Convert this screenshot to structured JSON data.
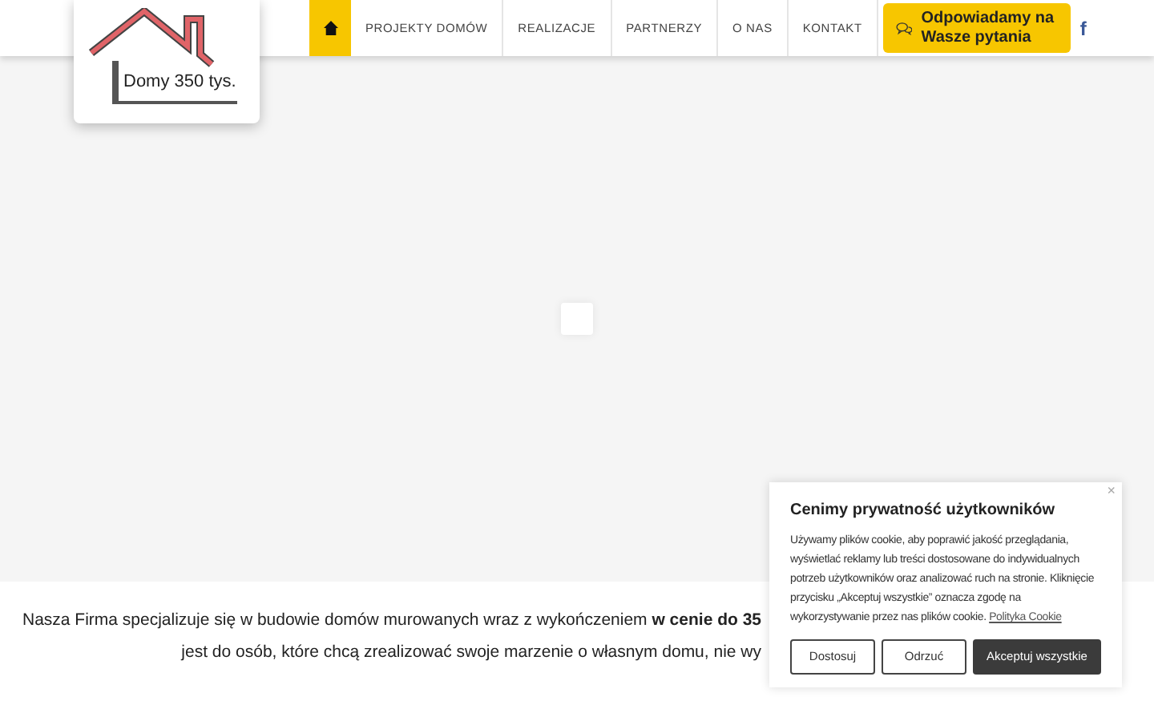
{
  "logo": {
    "text": "Domy 350 tys."
  },
  "nav": {
    "items": [
      {
        "label": "PROJEKTY DOMÓW"
      },
      {
        "label": "REALIZACJE"
      },
      {
        "label": "PARTNERZY"
      },
      {
        "label": "O NAS"
      },
      {
        "label": "KONTAKT"
      }
    ],
    "cta": {
      "label": "Odpowiadamy na Wasze pytania"
    },
    "social": {
      "label": "f"
    }
  },
  "intro": {
    "lines": [
      "Nasza Firma specjalizuje się w budowie domów murowanych wraz z wykończeniem **w cenie do 35**",
      "jest do osób, które chcą zrealizować swoje marzenie o własnym domu, nie wy"
    ]
  },
  "cookie_banner": {
    "close": "×",
    "title": "Cenimy prywatność użytkowników",
    "text": "Używamy plików cookie, aby poprawić jakość przeglądania, wyświetlać reklamy lub treści dostosowane do indywidualnych potrzeb użytkowników oraz analizować ruch na stronie. Kliknięcie przycisku „Akceptuj wszystkie” oznacza zgodę na wykorzystywanie przez nas plików cookie.",
    "link": "Polityka Cookie",
    "buttons": [
      {
        "label": "Dostosuj",
        "kind": "outline"
      },
      {
        "label": "Odrzuć",
        "kind": "outline"
      },
      {
        "label": "Akceptuj wszystkie",
        "kind": "filled"
      }
    ]
  }
}
